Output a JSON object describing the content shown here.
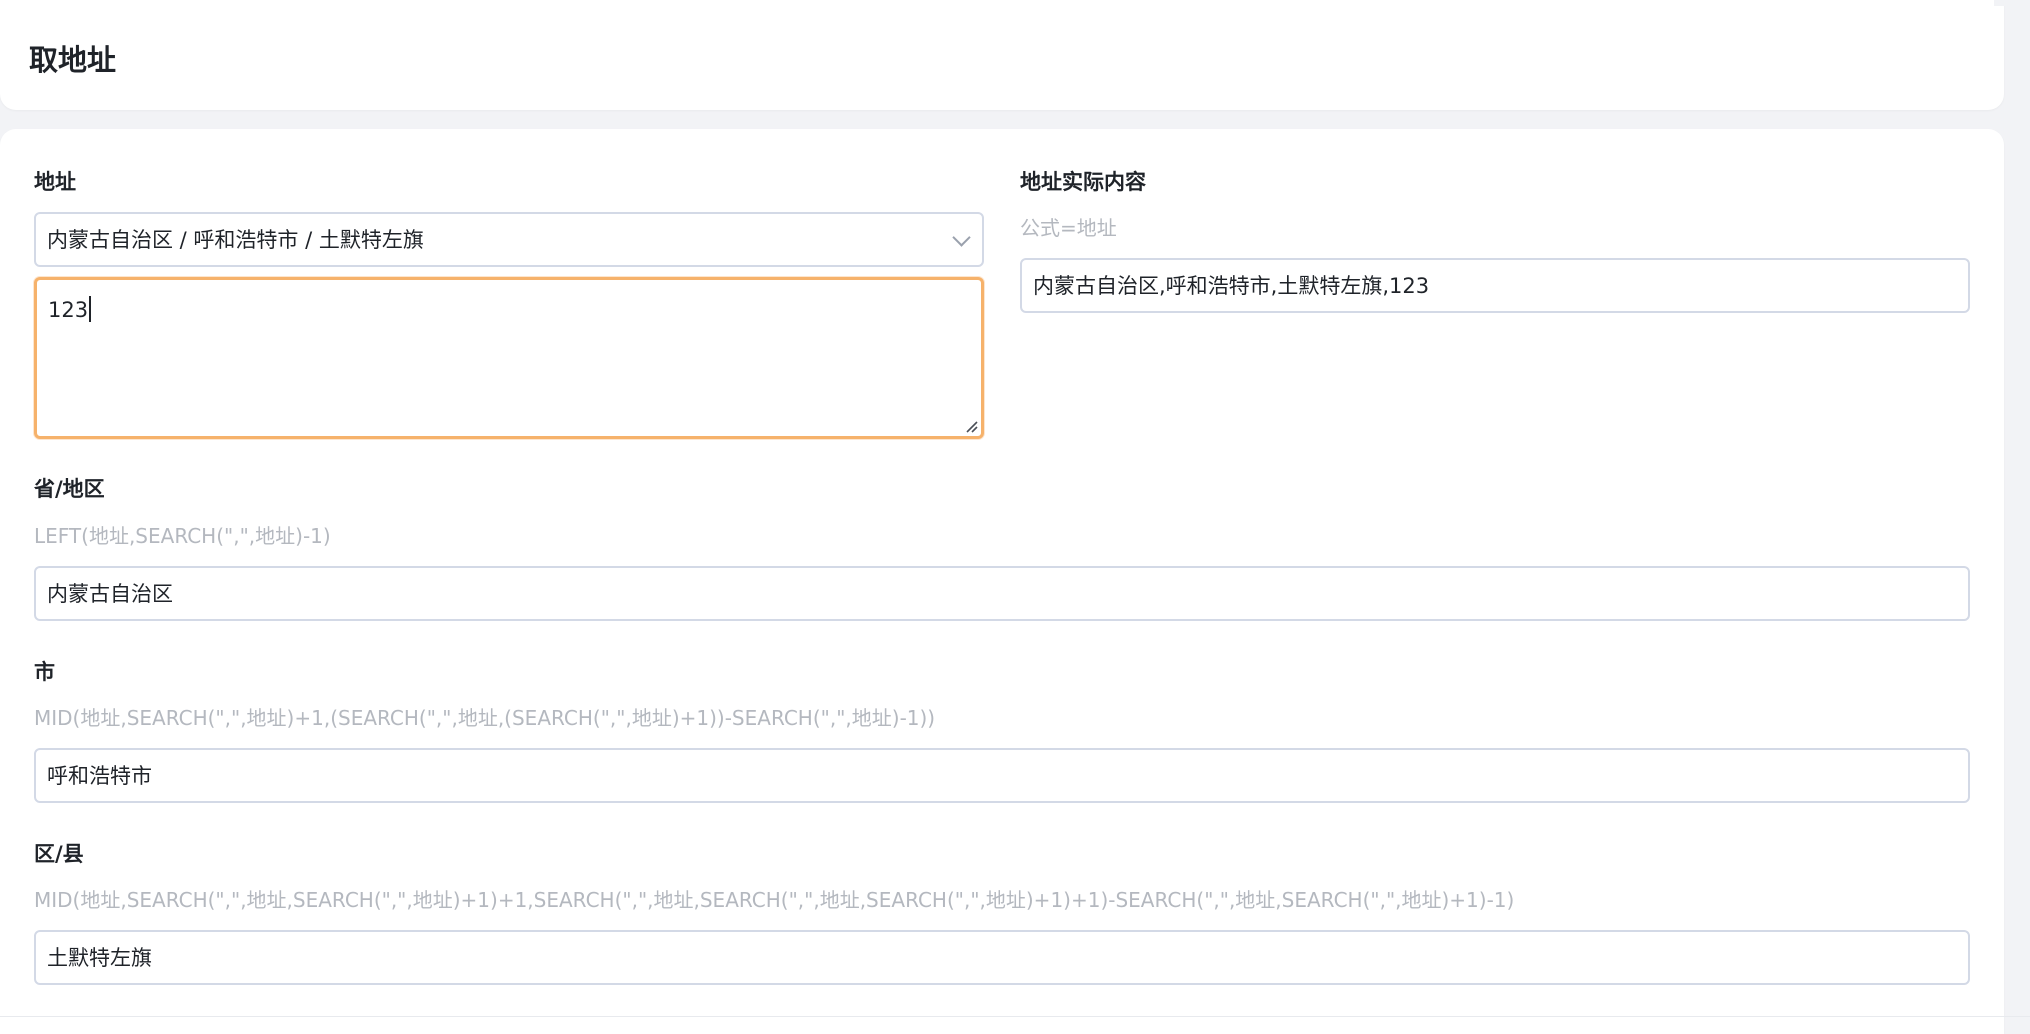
{
  "page": {
    "title": "取地址"
  },
  "form": {
    "address": {
      "label": "地址",
      "region_value": "内蒙古自治区 / 呼和浩特市 / 土默特左旗",
      "detail_value": "123"
    },
    "address_actual": {
      "label": "地址实际内容",
      "formula": "公式=地址",
      "value": "内蒙古自治区,呼和浩特市,土默特左旗,123"
    },
    "province": {
      "label": "省/地区",
      "formula": "LEFT(地址,SEARCH(\",\",地址)-1)",
      "value": "内蒙古自治区"
    },
    "city": {
      "label": "市",
      "formula": "MID(地址,SEARCH(\",\",地址)+1,(SEARCH(\",\",地址,(SEARCH(\",\",地址)+1))-SEARCH(\",\",地址)-1))",
      "value": "呼和浩特市"
    },
    "district": {
      "label": "区/县",
      "formula": "MID(地址,SEARCH(\",\",地址,SEARCH(\",\",地址)+1)+1,SEARCH(\",\",地址,SEARCH(\",\",地址,SEARCH(\",\",地址)+1)+1)-SEARCH(\",\",地址,SEARCH(\",\",地址)+1)-1)",
      "value": "土默特左旗"
    }
  },
  "icons": {
    "select_chevron": "chevron-down-icon",
    "textarea_resize": "resize-handle-icon"
  },
  "colors": {
    "focus_border": "#f6b26b",
    "input_border": "#d3d9e6",
    "hint_text": "#b4b8bf",
    "background": "#f2f3f6"
  }
}
